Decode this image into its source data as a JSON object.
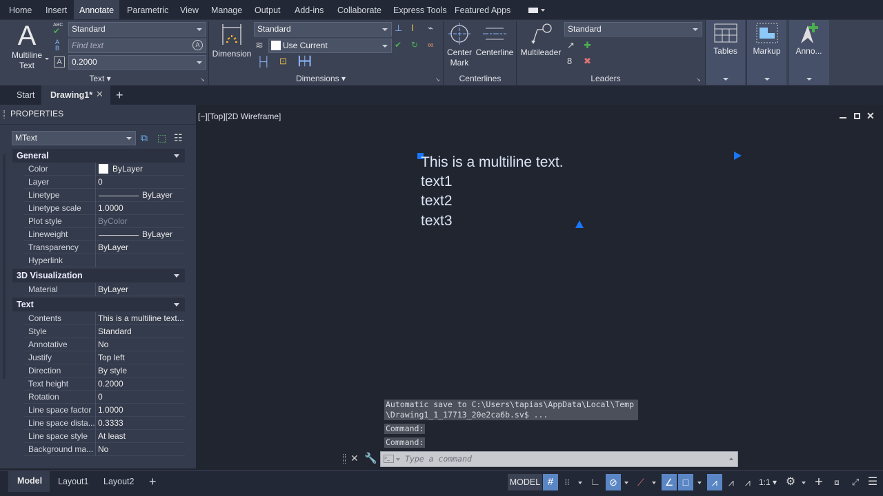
{
  "menu_tabs": [
    {
      "label": "Home",
      "active": false
    },
    {
      "label": "Insert",
      "active": false
    },
    {
      "label": "Annotate",
      "active": true
    },
    {
      "label": "Parametric",
      "active": false
    },
    {
      "label": "View",
      "active": false
    },
    {
      "label": "Manage",
      "active": false
    },
    {
      "label": "Output",
      "active": false
    },
    {
      "label": "Add-ins",
      "active": false
    },
    {
      "label": "Collaborate",
      "active": false
    },
    {
      "label": "Express Tools",
      "active": false
    },
    {
      "label": "Featured Apps",
      "active": false
    }
  ],
  "ribbon": {
    "text_panel": {
      "multiline_text_label": "Multiline",
      "multiline_text_label2": "Text",
      "style_value": "Standard",
      "find_placeholder": "Find text",
      "height_value": "0.2000",
      "panel_label": "Text"
    },
    "dimensions_panel": {
      "dimension_label": "Dimension",
      "style_value": "Standard",
      "layer_value": "Use Current",
      "panel_label": "Dimensions"
    },
    "centerlines_panel": {
      "center_mark_label": "Center",
      "center_mark_label2": "Mark",
      "centerline_label": "Centerline",
      "panel_label": "Centerlines"
    },
    "leaders_panel": {
      "multileader_label": "Multileader",
      "style_value": "Standard",
      "panel_label": "Leaders"
    },
    "tables_label": "Tables",
    "markup_label": "Markup",
    "anno_label": "Anno..."
  },
  "doc_tabs": {
    "start": "Start",
    "drawing": "Drawing1*",
    "add": "+"
  },
  "properties": {
    "title": "PROPERTIES",
    "object_type": "MText",
    "sections": {
      "general": {
        "title": "General",
        "rows": [
          {
            "key": "Color",
            "value": "ByLayer"
          },
          {
            "key": "Layer",
            "value": "0"
          },
          {
            "key": "Linetype",
            "value": "ByLayer"
          },
          {
            "key": "Linetype scale",
            "value": "1.0000"
          },
          {
            "key": "Plot style",
            "value": "ByColor"
          },
          {
            "key": "Lineweight",
            "value": "ByLayer"
          },
          {
            "key": "Transparency",
            "value": "ByLayer"
          },
          {
            "key": "Hyperlink",
            "value": ""
          }
        ]
      },
      "viz3d": {
        "title": "3D Visualization",
        "rows": [
          {
            "key": "Material",
            "value": "ByLayer"
          }
        ]
      },
      "text": {
        "title": "Text",
        "rows": [
          {
            "key": "Contents",
            "value": "This is a multiline text..."
          },
          {
            "key": "Style",
            "value": "Standard"
          },
          {
            "key": "Annotative",
            "value": "No"
          },
          {
            "key": "Justify",
            "value": "Top left"
          },
          {
            "key": "Direction",
            "value": "By style"
          },
          {
            "key": "Text height",
            "value": "0.2000"
          },
          {
            "key": "Rotation",
            "value": "0"
          },
          {
            "key": "Line space factor",
            "value": "1.0000"
          },
          {
            "key": "Line space dista...",
            "value": "0.3333"
          },
          {
            "key": "Line space style",
            "value": "At least"
          },
          {
            "key": "Background ma...",
            "value": "No"
          }
        ]
      }
    }
  },
  "viewport": {
    "label": "[−][Top][2D Wireframe]",
    "mtext_lines": [
      "This is a multiline text.",
      "text1",
      "text2",
      "text3"
    ]
  },
  "command_line": {
    "history": [
      "Automatic save to C:\\Users\\tapias\\AppData\\Local\\Temp",
      "\\Drawing1_1_17713_20e2ca6b.sv$ ...",
      "Command:",
      "Command:"
    ],
    "placeholder": "Type a command"
  },
  "layout_tabs": [
    "Model",
    "Layout1",
    "Layout2",
    "+"
  ],
  "status_bar": {
    "model_label": "MODEL",
    "scale_label": "1:1"
  },
  "colors": {
    "accent": "#1e88e5",
    "grip": "#1976ff",
    "ribbon_bg": "#3b4254",
    "canvas_bg": "#212530"
  }
}
